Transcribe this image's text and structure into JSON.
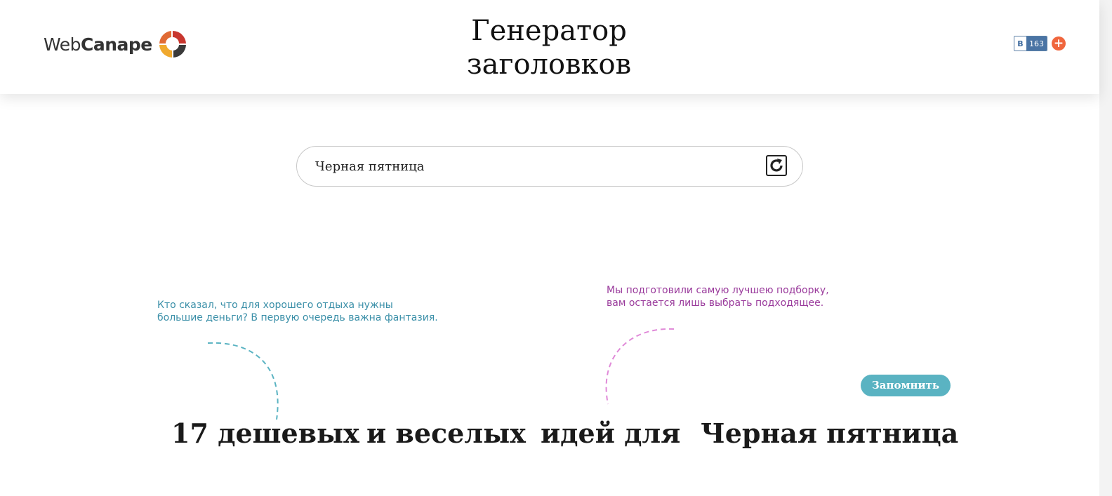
{
  "header": {
    "logo": {
      "text_light": "Web",
      "text_bold": "Canape"
    },
    "title_line1": "Генератор",
    "title_line2": "заголовков",
    "share": {
      "vk_label": "В",
      "vk_count": "163",
      "plus_label": "+"
    }
  },
  "search": {
    "value": "Черная пятница",
    "refresh_icon": "refresh-icon"
  },
  "hints": {
    "left": "Кто сказал, что для хорошего отдыха нужны большие деньги? В первую очередь важна фантазия.",
    "right": "Мы подготовили самую лучшею подборку, вам остается лишь выбрать подходящее."
  },
  "remember_label": "Запомнить",
  "headline": {
    "parts": [
      "17 дешевых",
      "и веселых",
      "идей для",
      "Черная пятница"
    ]
  },
  "colors": {
    "hint_left": "#3a8fa8",
    "hint_right": "#9a3b9c",
    "button": "#5ab3c2",
    "logo_red": "#c8362e",
    "logo_yellow": "#f0a92e",
    "logo_dark": "#3a3a3a"
  }
}
